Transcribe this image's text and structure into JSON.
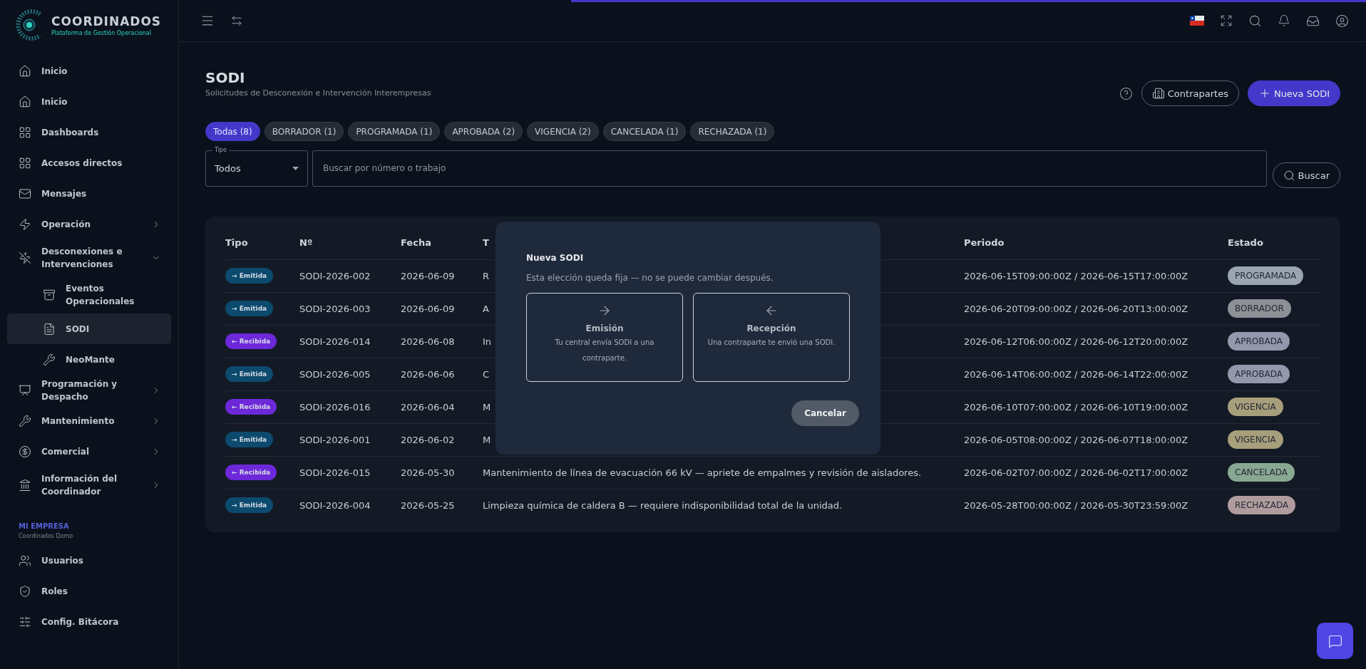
{
  "brand": {
    "name": "COORDINADOS",
    "tagline": "Plataforma de Gestión Operacional"
  },
  "sidebar": {
    "items": [
      {
        "label": "Inicio",
        "kind": "link",
        "selected": false
      },
      {
        "label": "Inicio",
        "kind": "link",
        "selected": false
      },
      {
        "label": "Dashboards",
        "kind": "link",
        "selected": false
      },
      {
        "label": "Accesos directos",
        "kind": "link",
        "selected": false
      },
      {
        "label": "Mensajes",
        "kind": "link",
        "selected": false
      },
      {
        "label": "Operación",
        "kind": "group",
        "expanded": false,
        "selected": false
      },
      {
        "label": "Desconexiones e Intervenciones",
        "kind": "group",
        "expanded": true,
        "selected": false,
        "children": [
          {
            "label": "Eventos Operacionales",
            "selected": false
          },
          {
            "label": "SODI",
            "selected": true
          },
          {
            "label": "NeoMante",
            "selected": false
          }
        ]
      },
      {
        "label": "Programación y Despacho",
        "kind": "group",
        "expanded": false,
        "selected": false
      },
      {
        "label": "Mantenimiento",
        "kind": "group",
        "expanded": false,
        "selected": false
      },
      {
        "label": "Comercial",
        "kind": "group",
        "expanded": false,
        "selected": false
      },
      {
        "label": "Información del Coordinador",
        "kind": "group",
        "expanded": false,
        "selected": false
      }
    ],
    "company": {
      "heading": "MI EMPRESA",
      "name": "Coordinados Demo"
    },
    "company_items": [
      {
        "label": "Usuarios",
        "selected": false
      },
      {
        "label": "Roles",
        "selected": false
      },
      {
        "label": "Config. Bitácora",
        "selected": false
      }
    ]
  },
  "page": {
    "title": "SODI",
    "subtitle": "Solicitudes de Desconexión e Intervención Interempresas",
    "buttons": [
      "Contrapartes",
      "Nueva SODI"
    ]
  },
  "filters": [
    {
      "label": "Todas (8)",
      "selected": true
    },
    {
      "label": "BORRADOR (1)",
      "selected": false
    },
    {
      "label": "PROGRAMADA (1)",
      "selected": false
    },
    {
      "label": "APROBADA (2)",
      "selected": false
    },
    {
      "label": "VIGENCIA (2)",
      "selected": false
    },
    {
      "label": "CANCELADA (1)",
      "selected": false
    },
    {
      "label": "RECHAZADA (1)",
      "selected": false
    }
  ],
  "type_select": {
    "label": "Tipo",
    "value": "Todos"
  },
  "search": {
    "placeholder": "Buscar por número o trabajo",
    "button": "Buscar"
  },
  "table": {
    "columns": [
      "Tipo",
      "Nº",
      "Fecha",
      "T",
      "Periodo",
      "Estado"
    ],
    "rows": [
      {
        "tipo": {
          "label": "→ Emitida",
          "kind": "sent"
        },
        "numero": "SODI-2026-002",
        "fecha": "2026-06-09",
        "titulo": "R",
        "periodo": "2026-06-15T09:00:00Z / 2026-06-15T17:00:00Z",
        "estado": "PROGRAMADA",
        "color": "#9ba4b3"
      },
      {
        "tipo": {
          "label": "→ Emitida",
          "kind": "sent"
        },
        "numero": "SODI-2026-003",
        "fecha": "2026-06-09",
        "titulo": "A",
        "periodo": "2026-06-20T09:00:00Z / 2026-06-20T13:00:00Z",
        "estado": "BORRADOR",
        "color": "#8e9097"
      },
      {
        "tipo": {
          "label": "← Recibida",
          "kind": "received"
        },
        "numero": "SODI-2026-014",
        "fecha": "2026-06-08",
        "titulo": "In",
        "periodo": "2026-06-12T06:00:00Z / 2026-06-12T20:00:00Z",
        "estado": "APROBADA",
        "color": "#9398ac"
      },
      {
        "tipo": {
          "label": "→ Emitida",
          "kind": "sent"
        },
        "numero": "SODI-2026-005",
        "fecha": "2026-06-06",
        "titulo": "C",
        "periodo": "2026-06-14T06:00:00Z / 2026-06-14T22:00:00Z",
        "estado": "APROBADA",
        "color": "#9398ac"
      },
      {
        "tipo": {
          "label": "← Recibida",
          "kind": "received"
        },
        "numero": "SODI-2026-016",
        "fecha": "2026-06-04",
        "titulo": "M",
        "periodo": "2026-06-10T07:00:00Z / 2026-06-10T19:00:00Z",
        "estado": "VIGENCIA",
        "color": "#a79e7b"
      },
      {
        "tipo": {
          "label": "→ Emitida",
          "kind": "sent"
        },
        "numero": "SODI-2026-001",
        "fecha": "2026-06-02",
        "titulo": "M",
        "periodo": "2026-06-05T08:00:00Z / 2026-06-07T18:00:00Z",
        "estado": "VIGENCIA",
        "color": "#a79e7b"
      },
      {
        "tipo": {
          "label": "← Recibida",
          "kind": "received"
        },
        "numero": "SODI-2026-015",
        "fecha": "2026-05-30",
        "titulo": "Mantenimiento de línea de evacuación 66 kV — apriete de empalmes y revisión de aisladores.",
        "periodo": "2026-06-02T07:00:00Z / 2026-06-02T17:00:00Z",
        "estado": "CANCELADA",
        "color": "#88a892"
      },
      {
        "tipo": {
          "label": "→ Emitida",
          "kind": "sent"
        },
        "numero": "SODI-2026-004",
        "fecha": "2026-05-25",
        "titulo": "Limpieza química de caldera B — requiere indisponibilidad total de la unidad.",
        "periodo": "2026-05-28T00:00:00Z / 2026-05-30T23:59:00Z",
        "estado": "RECHAZADA",
        "color": "#b09c9e"
      }
    ]
  },
  "dialog": {
    "title": "Nueva SODI",
    "text": "Esta elección queda fija — no se puede cambiar después.",
    "options": [
      {
        "title": "Emisión",
        "text": "Tu central envía SODI a una contraparte.",
        "kind": "out"
      },
      {
        "title": "Recepción",
        "text": "Una contraparte te envió una SODI.",
        "kind": "in"
      }
    ],
    "cancel": "Cancelar"
  }
}
